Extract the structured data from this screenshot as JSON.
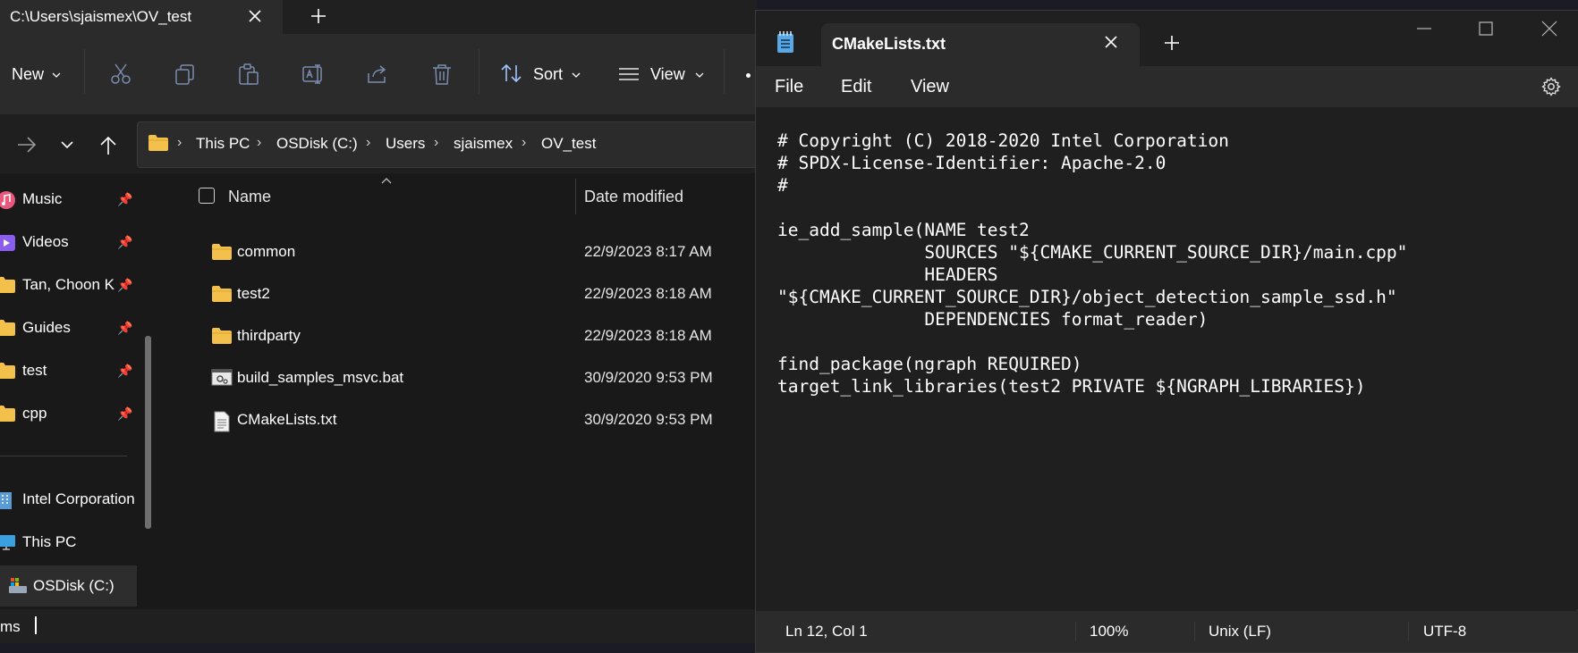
{
  "explorer": {
    "tab_title": "C:\\Users\\sjaismex\\OV_test",
    "toolbar": {
      "new_label": "New",
      "sort_label": "Sort",
      "view_label": "View"
    },
    "breadcrumb": [
      "This PC",
      "OSDisk (C:)",
      "Users",
      "sjaismex",
      "OV_test"
    ],
    "sidebar": {
      "quick_access": [
        {
          "label": "Music",
          "icon": "music-icon"
        },
        {
          "label": "Videos",
          "icon": "videos-icon"
        },
        {
          "label": "Tan, Choon K",
          "icon": "folder-icon"
        },
        {
          "label": "Guides",
          "icon": "folder-icon"
        },
        {
          "label": "test",
          "icon": "folder-icon"
        },
        {
          "label": "cpp",
          "icon": "folder-icon"
        }
      ],
      "locations": [
        {
          "label": "Intel Corporation",
          "icon": "building-icon"
        },
        {
          "label": "This PC",
          "icon": "computer-icon"
        },
        {
          "label": "OSDisk (C:)",
          "icon": "drive-icon"
        }
      ]
    },
    "columns": {
      "name": "Name",
      "date": "Date modified"
    },
    "files": [
      {
        "name": "common",
        "date": "22/9/2023 8:17 AM",
        "type": "folder"
      },
      {
        "name": "test2",
        "date": "22/9/2023 8:18 AM",
        "type": "folder"
      },
      {
        "name": "thirdparty",
        "date": "22/9/2023 8:18 AM",
        "type": "folder"
      },
      {
        "name": "build_samples_msvc.bat",
        "date": "30/9/2020 9:53 PM",
        "type": "batch"
      },
      {
        "name": "CMakeLists.txt",
        "date": "30/9/2020 9:53 PM",
        "type": "text"
      }
    ],
    "status": "ms"
  },
  "notepad": {
    "tab_title": "CMakeLists.txt",
    "menu": [
      "File",
      "Edit",
      "View"
    ],
    "content": "# Copyright (C) 2018-2020 Intel Corporation\n# SPDX-License-Identifier: Apache-2.0\n#\n\nie_add_sample(NAME test2\n              SOURCES \"${CMAKE_CURRENT_SOURCE_DIR}/main.cpp\"\n              HEADERS\n\"${CMAKE_CURRENT_SOURCE_DIR}/object_detection_sample_ssd.h\"\n              DEPENDENCIES format_reader)\n\nfind_package(ngraph REQUIRED)\ntarget_link_libraries(test2 PRIVATE ${NGRAPH_LIBRARIES})",
    "status": {
      "position": "Ln 12, Col 1",
      "zoom": "100%",
      "line_ending": "Unix (LF)",
      "encoding": "UTF-8"
    }
  },
  "colors": {
    "folder": "#f3c14b",
    "notepad_icon": "#5aa7e6",
    "accent": "#0078d4"
  }
}
